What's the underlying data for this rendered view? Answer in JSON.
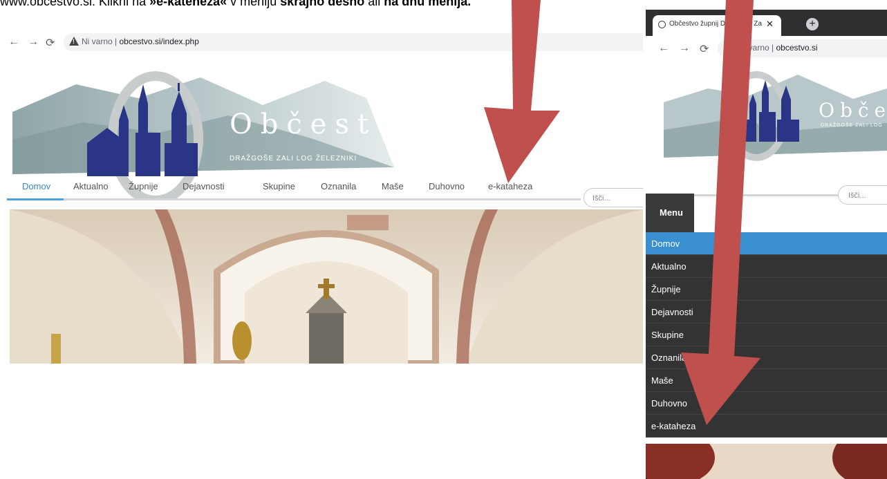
{
  "instruction": {
    "prefix": "www.obcestvo.si. Klikni na ",
    "link": "»e-kateheza«",
    "middle": " v meniju ",
    "place1": "skrajno desno",
    "or": " ali ",
    "place2": "na dnu menija."
  },
  "left": {
    "address": {
      "warning": "Ni varno",
      "separator": "|",
      "url": "obcestvo.si/index.php"
    },
    "logo": {
      "title": "Občestvo",
      "subtitle": "DRAŽGOŠE   ZALI LOG   ŽELEZNIKI"
    },
    "search_placeholder": "Išči...",
    "menu": [
      "Domov",
      "Aktualno",
      "Župnije",
      "Dejavnosti",
      "Skupine",
      "Oznanila",
      "Maše",
      "Duhovno",
      "e-kataheza"
    ]
  },
  "right": {
    "tab_title": "Občestvo župnij Dražgoše, Zali Log",
    "address": {
      "warning": "Ni varno",
      "separator": "|",
      "url": "obcestvo.si"
    },
    "logo": {
      "title": "Občes",
      "subtitle": "DRAŽGOŠE  ZALI LOG"
    },
    "search_placeholder": "Išči...",
    "menu_button": "Menu",
    "menu": [
      "Domov",
      "Aktualno",
      "Župnije",
      "Dejavnosti",
      "Skupine",
      "Oznanila",
      "Maše",
      "Duhovno",
      "e-kataheza"
    ]
  },
  "colors": {
    "arrow": "#c0504d",
    "accent": "#3a8fd0",
    "church": "#2b3585"
  }
}
